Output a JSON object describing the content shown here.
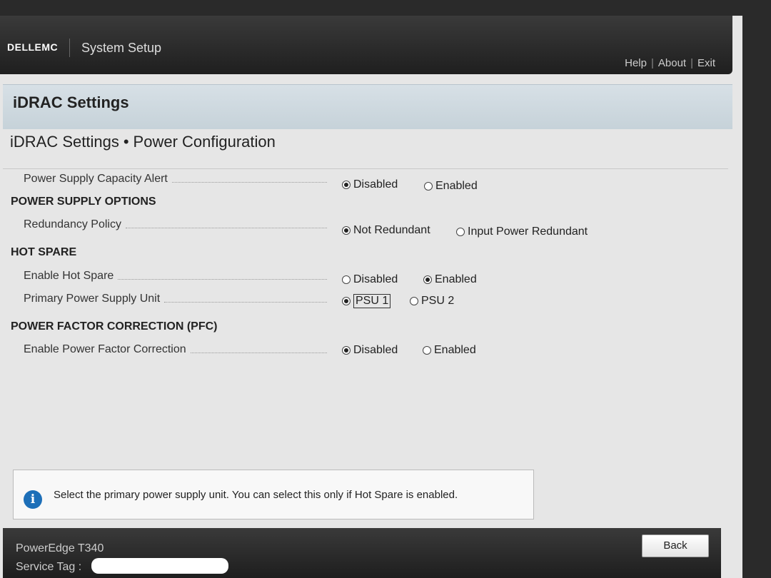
{
  "header": {
    "brand": "DELLEMC",
    "app_title": "System Setup",
    "links": [
      "Help",
      "About",
      "Exit"
    ],
    "separator": "|"
  },
  "section": {
    "title": "iDRAC Settings",
    "breadcrumb": [
      "iDRAC Settings",
      "Power Configuration"
    ],
    "breadcrumb_sep": "•"
  },
  "settings": {
    "capacity_alert": {
      "label": "Power Supply Capacity Alert",
      "options": [
        "Disabled",
        "Enabled"
      ],
      "selected": "Disabled"
    },
    "power_supply_options": {
      "heading": "POWER SUPPLY OPTIONS",
      "redundancy_policy": {
        "label": "Redundancy Policy",
        "options": [
          "Not Redundant",
          "Input Power Redundant"
        ],
        "selected": "Not Redundant"
      }
    },
    "hot_spare": {
      "heading": "HOT SPARE",
      "enable_hot_spare": {
        "label": "Enable Hot Spare",
        "options": [
          "Disabled",
          "Enabled"
        ],
        "selected": "Enabled"
      },
      "primary_psu": {
        "label": "Primary Power Supply Unit",
        "options": [
          "PSU 1",
          "PSU 2"
        ],
        "selected": "PSU 1"
      }
    },
    "pfc": {
      "heading": "POWER FACTOR CORRECTION (PFC)",
      "enable_pfc": {
        "label": "Enable Power Factor Correction",
        "options": [
          "Disabled",
          "Enabled"
        ],
        "selected": "Disabled"
      }
    }
  },
  "help": {
    "icon": "info-icon",
    "icon_glyph": "i",
    "text": "Select the primary power supply unit. You can select this only if Hot Spare is enabled."
  },
  "footer": {
    "model": "PowerEdge T340",
    "service_tag_label": "Service Tag :",
    "back_label": "Back"
  },
  "colors": {
    "header_bg": "#2b2b2b",
    "section_bg": "#cfd9df",
    "info_blue": "#1d6fb8"
  }
}
